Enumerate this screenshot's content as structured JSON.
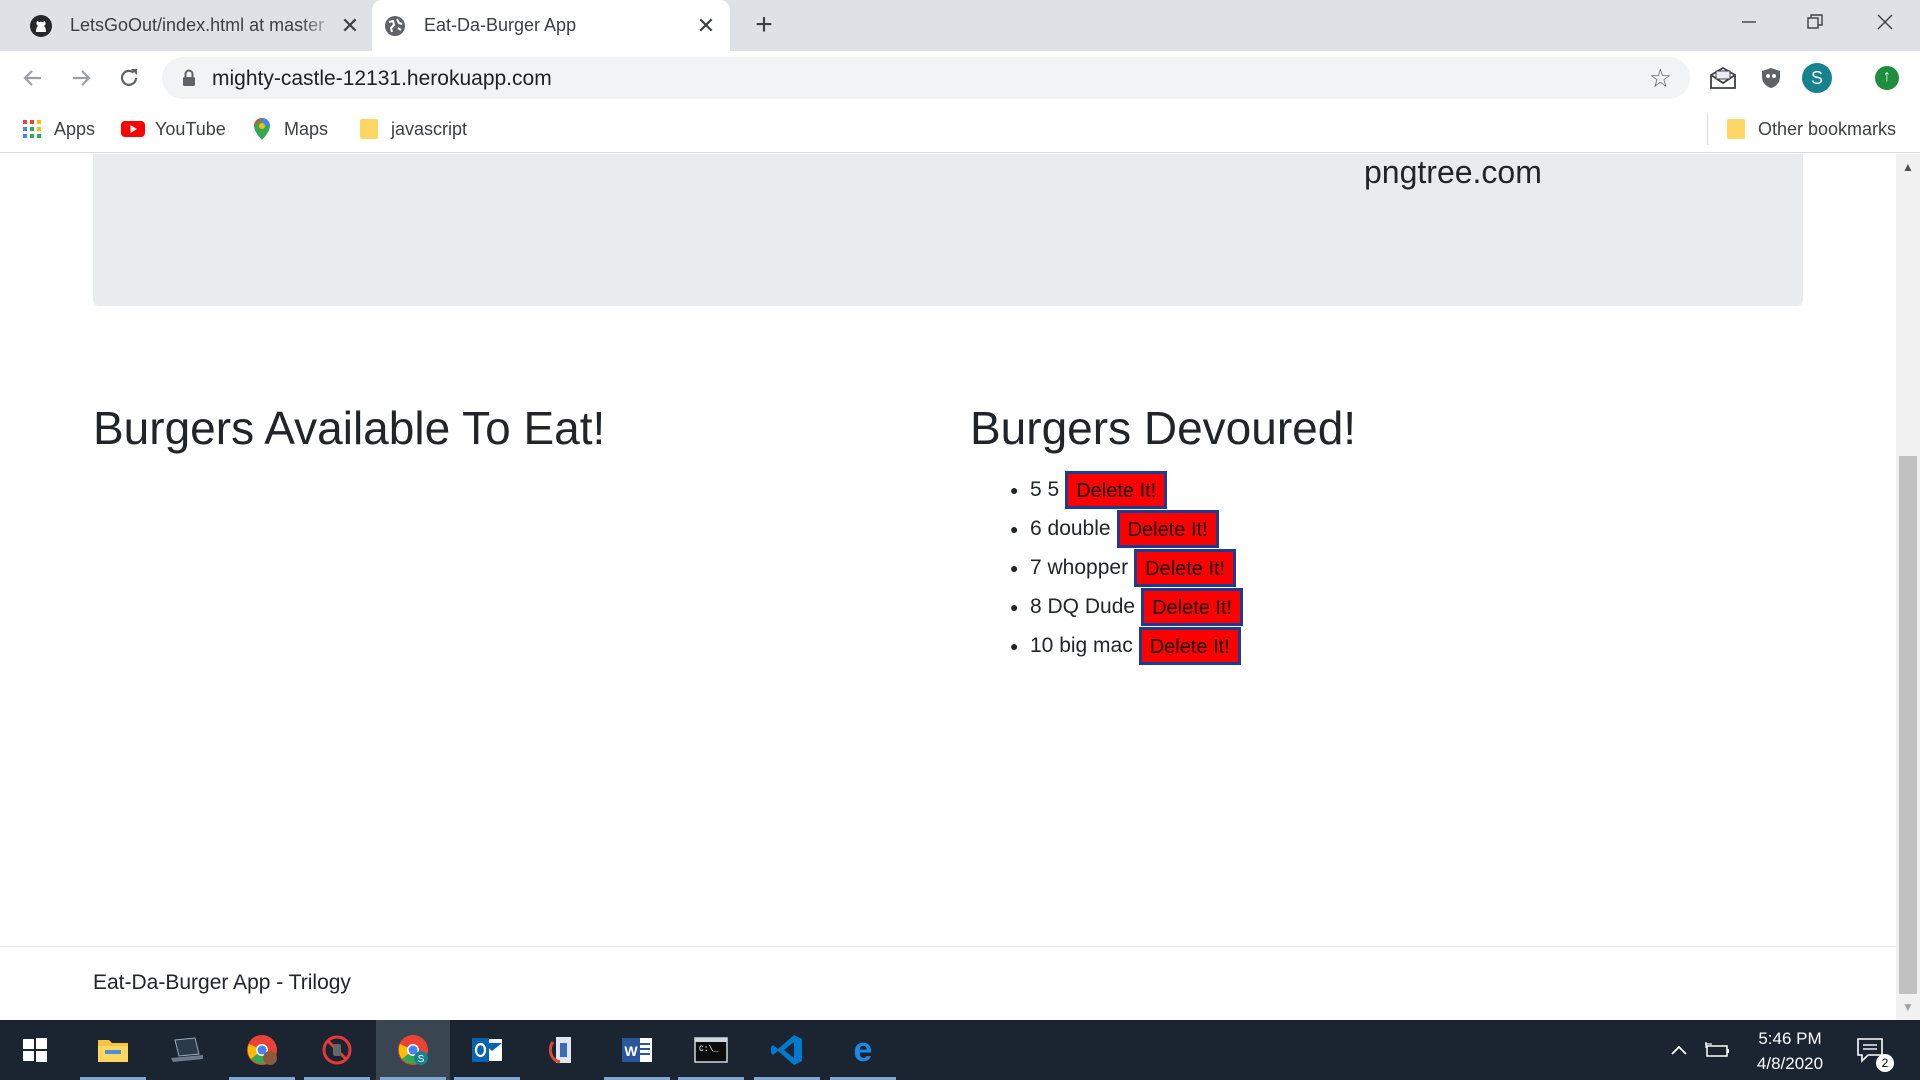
{
  "browser": {
    "tabs": [
      {
        "title": "LetsGoOut/index.html at master",
        "favicon": "github-icon"
      },
      {
        "title": "Eat-Da-Burger App",
        "favicon": "globe-icon"
      }
    ],
    "url": "mighty-castle-12131.herokuapp.com",
    "profile_initial": "S",
    "bookmarks": [
      {
        "label": "Apps",
        "icon": "apps-grid-icon"
      },
      {
        "label": "YouTube",
        "icon": "youtube-icon"
      },
      {
        "label": "Maps",
        "icon": "maps-pin-icon"
      },
      {
        "label": "javascript",
        "icon": "folder-icon"
      }
    ],
    "other_bookmarks": "Other bookmarks"
  },
  "page": {
    "jumbotron_text": "pngtree.com",
    "left_heading": "Burgers Available To Eat!",
    "right_heading": "Burgers Devoured!",
    "devoured": [
      {
        "name": "5 5",
        "button": "Delete It!"
      },
      {
        "name": "6 double",
        "button": "Delete It!"
      },
      {
        "name": "7 whopper",
        "button": "Delete It!"
      },
      {
        "name": "8 DQ Dude",
        "button": "Delete It!"
      },
      {
        "name": "10 big mac",
        "button": "Delete It!"
      }
    ],
    "footer": "Eat-Da-Burger App - Trilogy"
  },
  "taskbar": {
    "time": "5:46 PM",
    "date": "4/8/2020",
    "notification_count": "2",
    "apps": [
      "file-explorer-icon",
      "laptop-app-icon",
      "chrome-icon",
      "blocked-app-icon",
      "chrome-profile-icon",
      "outlook-icon",
      "app-icon",
      "word-icon",
      "terminal-icon",
      "vscode-icon",
      "edge-icon"
    ]
  },
  "colors": {
    "delete_button": "#ff0000",
    "delete_border": "#1f3a93",
    "jumbotron": "#e9ecef",
    "taskbar": "#1b2431"
  }
}
